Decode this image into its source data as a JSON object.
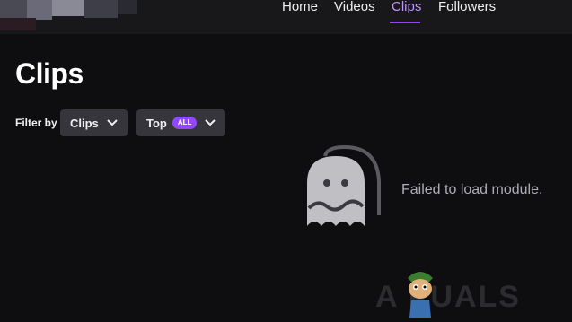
{
  "nav": {
    "items": [
      {
        "label": "Home"
      },
      {
        "label": "Videos"
      },
      {
        "label": "Clips",
        "active": true
      },
      {
        "label": "Followers"
      }
    ]
  },
  "page": {
    "title": "Clips"
  },
  "filter": {
    "label": "Filter by",
    "type_dropdown": {
      "value": "Clips"
    },
    "sort_dropdown": {
      "value": "Top",
      "badge": "ALL"
    }
  },
  "error": {
    "message": "Failed to load module.",
    "icon": "ghost-icon"
  },
  "watermark": {
    "text": "A PUALS"
  },
  "colors": {
    "background": "#0e0e10",
    "header": "#18181b",
    "accent": "#9147ff",
    "active_link": "#bf94ff",
    "dropdown": "#35353b",
    "muted_text": "#adadb8"
  }
}
